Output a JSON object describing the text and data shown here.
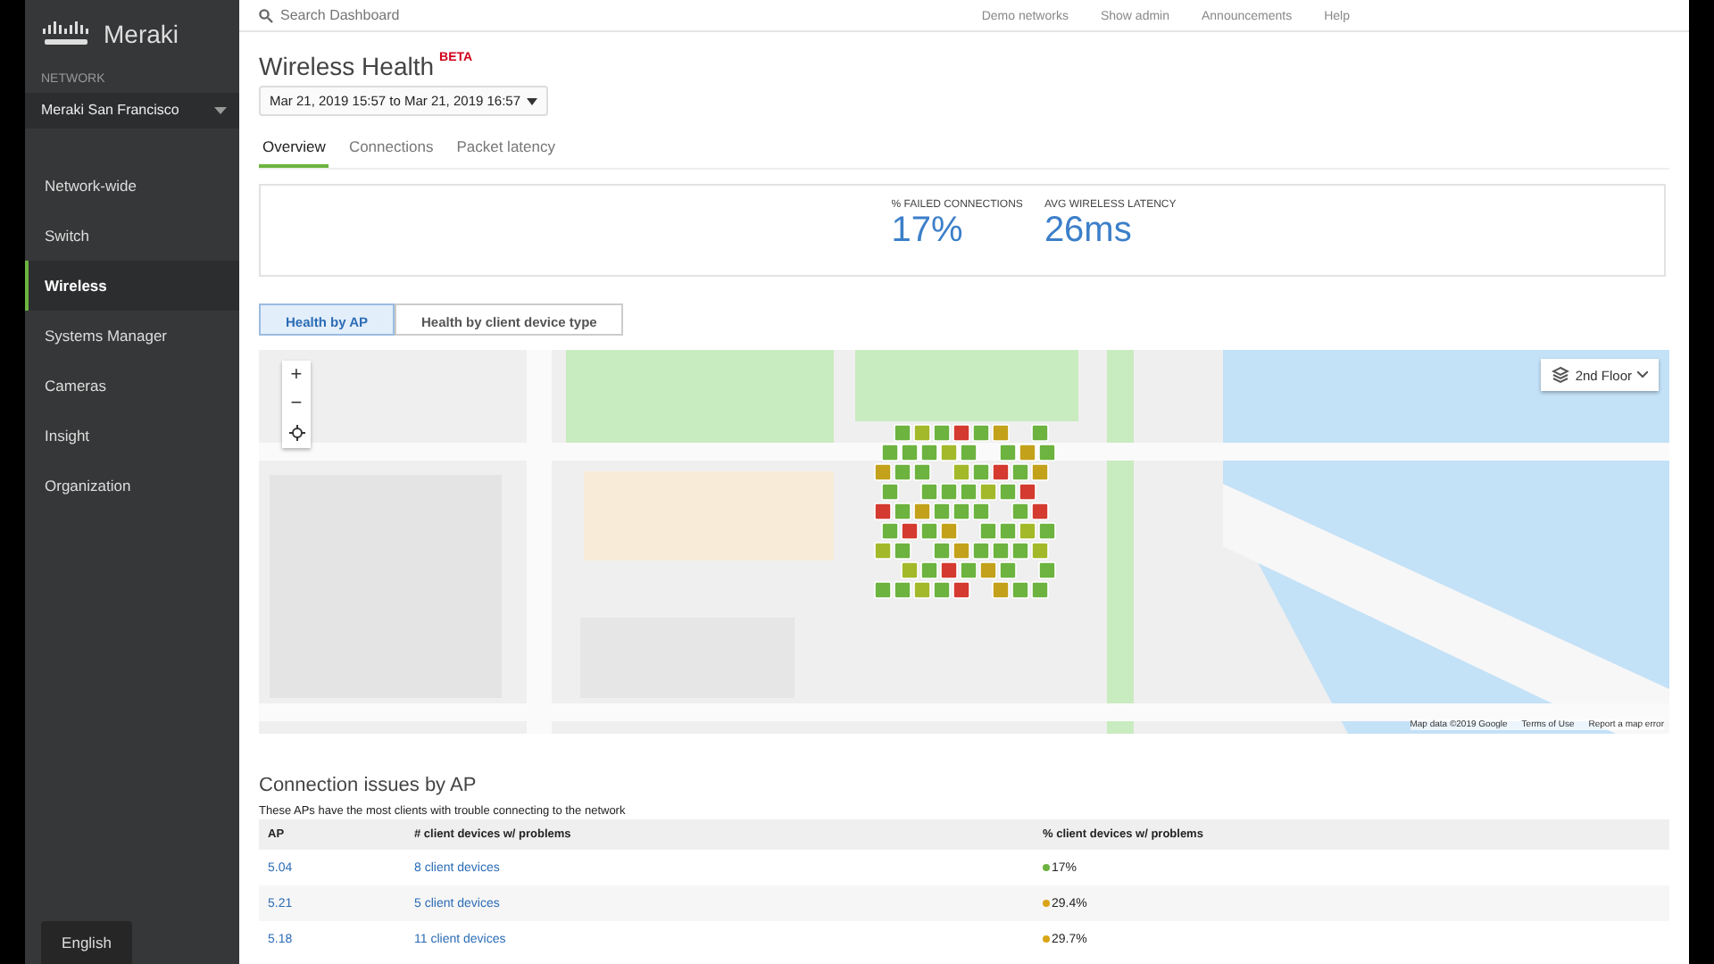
{
  "topbar": {
    "search": {
      "placeholder": "Search Dashboard"
    },
    "links": [
      "Demo networks",
      "Show admin",
      "Announcements",
      "Help"
    ]
  },
  "sidebar": {
    "brand": "Meraki",
    "network_label": "NETWORK",
    "network": "Meraki San Francisco",
    "items": [
      {
        "label": "Network-wide",
        "selected": false
      },
      {
        "label": "Switch",
        "selected": false
      },
      {
        "label": "Wireless",
        "selected": true
      },
      {
        "label": "Systems Manager",
        "selected": false
      },
      {
        "label": "Cameras",
        "selected": false
      },
      {
        "label": "Insight",
        "selected": false
      },
      {
        "label": "Organization",
        "selected": false
      }
    ],
    "language": "English"
  },
  "page": {
    "title": "Wireless Health",
    "badge": "BETA",
    "date_range": "Mar 21, 2019 15:57 to Mar 21, 2019 16:57",
    "tabs": [
      {
        "label": "Overview",
        "selected": true
      },
      {
        "label": "Connections",
        "selected": false
      },
      {
        "label": "Packet latency",
        "selected": false
      }
    ],
    "stats": [
      {
        "label": "% FAILED CONNECTIONS",
        "value": "17%"
      },
      {
        "label": "AVG WIRELESS LATENCY",
        "value": "26ms"
      }
    ],
    "views": [
      {
        "label": "Health by AP",
        "selected": true
      },
      {
        "label": "Health by client device type",
        "selected": false
      }
    ],
    "map": {
      "zoom_in": "+",
      "zoom_out": "−",
      "floor": "2nd Floor",
      "attribution": [
        "Map data ©2019 Google",
        "Terms of Use",
        "Report a map error"
      ]
    },
    "issues": {
      "title": "Connection issues by AP",
      "subtitle": "These APs have the most clients with trouble connecting to the network",
      "columns": [
        "AP",
        "# client devices w/ problems",
        "% client devices w/ problems"
      ],
      "rows": [
        {
          "ap": "5.04",
          "clients": "8 client devices",
          "percent": "17%",
          "color": "#6cb33f"
        },
        {
          "ap": "5.21",
          "clients": "5 client devices",
          "percent": "29.4%",
          "color": "#d9a514"
        },
        {
          "ap": "5.18",
          "clients": "11 client devices",
          "percent": "29.7%",
          "color": "#d9a514"
        }
      ]
    }
  }
}
